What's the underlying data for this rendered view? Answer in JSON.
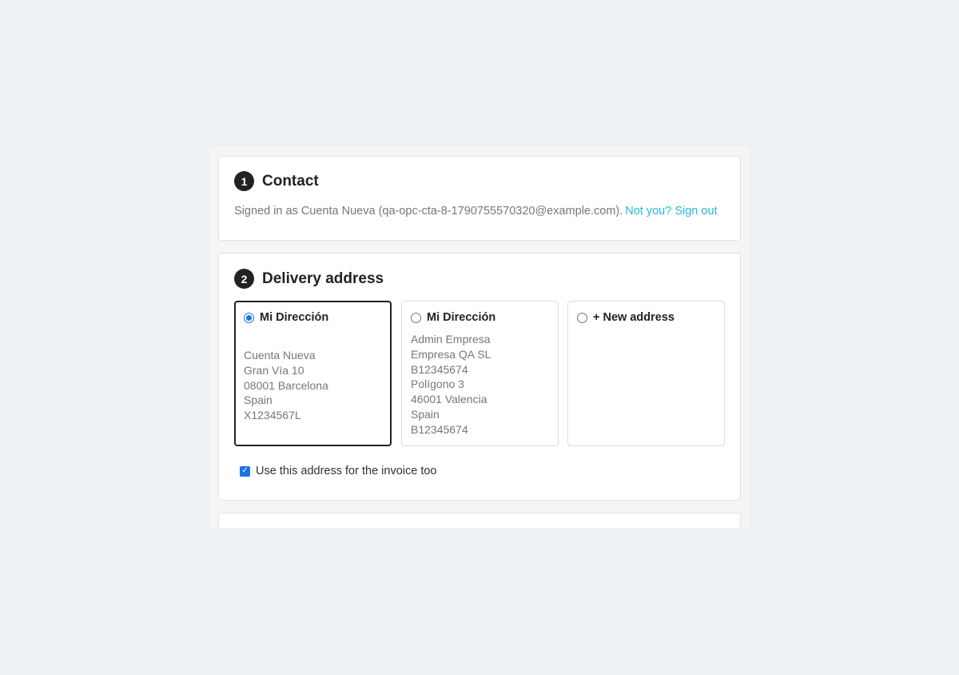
{
  "contact": {
    "step": "1",
    "title": "Contact",
    "signed_in_text": "Signed in as Cuenta Nueva (qa-opc-cta-8-1790755570320@example.com).",
    "sign_out_link": "Not you? Sign out"
  },
  "delivery": {
    "step": "2",
    "title": "Delivery address",
    "addresses": [
      {
        "title": "Mi Dirección",
        "selected": true,
        "lines": [
          "Cuenta Nueva",
          "Gran Vía 10",
          "08001 Barcelona",
          "Spain",
          "X1234567L"
        ]
      },
      {
        "title": "Mi Dirección",
        "selected": false,
        "lines": [
          "Admin Empresa",
          "Empresa QA SL",
          "B12345674",
          "Polígono 3",
          "46001 Valencia",
          "Spain",
          "B12345674"
        ]
      },
      {
        "title": "+ New address",
        "selected": false,
        "lines": []
      }
    ],
    "invoice_checkbox_label": "Use this address for the invoice too",
    "invoice_checkbox_checked": true
  },
  "colors": {
    "accent_link": "#25b9d7",
    "radio_checkbox": "#1a73e8",
    "step_badge": "#222222"
  }
}
